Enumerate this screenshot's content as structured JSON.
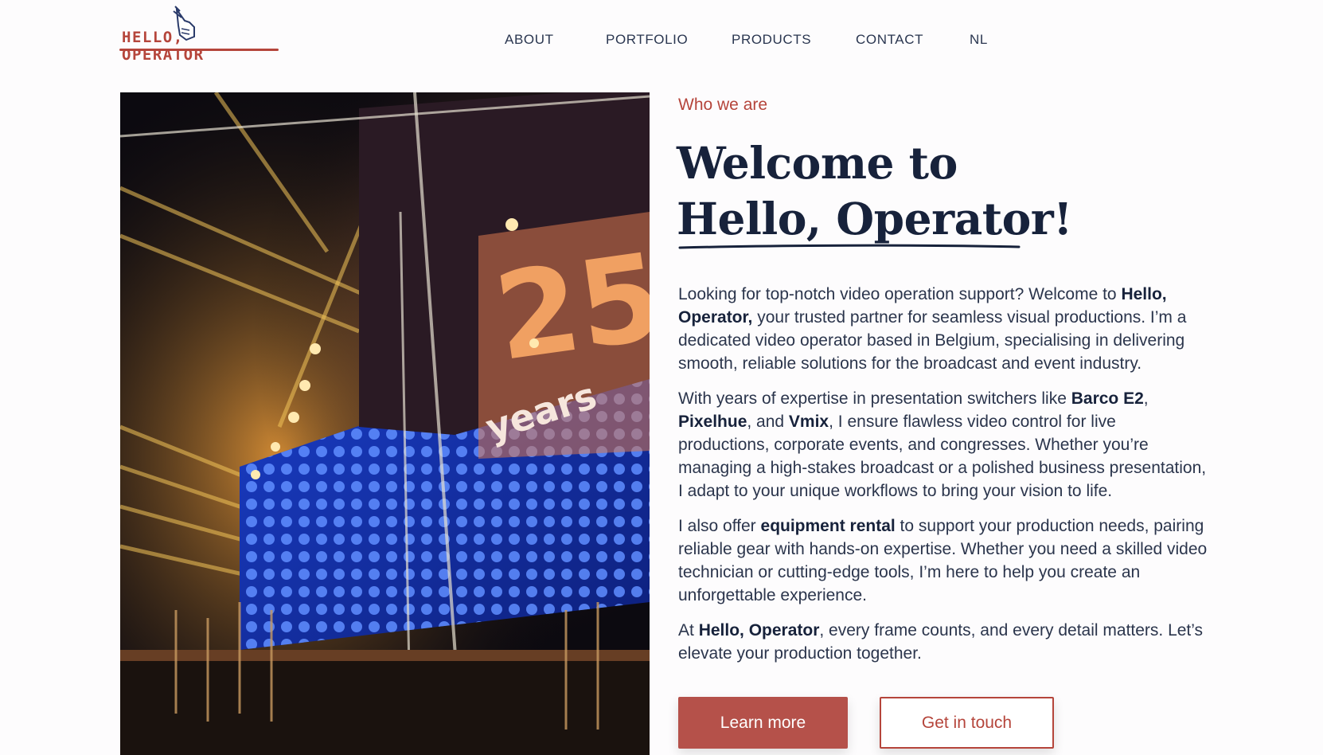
{
  "brand": {
    "logo_text_left": "HELLO,",
    "logo_text_right": "OPERATOR",
    "accent_color": "#b5453b",
    "navy_color": "#17223b"
  },
  "nav": {
    "items": [
      {
        "label": "ABOUT"
      },
      {
        "label": "PORTFOLIO"
      },
      {
        "label": "PRODUCTS"
      },
      {
        "label": "CONTACT"
      },
      {
        "label": "NL"
      }
    ]
  },
  "hero": {
    "image_overlay_number": "25",
    "image_overlay_word": "years"
  },
  "about": {
    "eyebrow": "Who we are",
    "heading_line1": "Welcome to",
    "heading_line2": "Hello, Operator!",
    "p1": [
      {
        "t": "Looking for top-notch video operation support? Welcome to "
      },
      {
        "t": "Hello, Operator,",
        "b": true
      },
      {
        "t": " your trusted partner for seamless visual productions. I’m a dedicated video operator based in Belgium, specialising in delivering smooth, reliable solutions for the broadcast and event industry."
      }
    ],
    "p2": [
      {
        "t": "With years of expertise in presentation switchers like "
      },
      {
        "t": "Barco E2",
        "b": true
      },
      {
        "t": ", "
      },
      {
        "t": "Pixelhue",
        "b": true
      },
      {
        "t": ", and "
      },
      {
        "t": "Vmix",
        "b": true
      },
      {
        "t": ", I ensure flawless video control for live productions, corporate events, and congresses. Whether you’re managing a high-stakes broadcast or a polished business presentation, I adapt to your unique workflows to bring your vision to life."
      }
    ],
    "p3": [
      {
        "t": "I also offer "
      },
      {
        "t": "equipment rental",
        "b": true
      },
      {
        "t": " to support your production needs, pairing reliable gear with hands-on expertise. Whether you need a skilled video technician or cutting-edge tools, I’m here to help you create an unforgettable experience."
      }
    ],
    "p4": [
      {
        "t": "At "
      },
      {
        "t": "Hello, Operator",
        "b": true
      },
      {
        "t": ", every frame counts, and every detail matters. Let’s elevate your production together."
      }
    ],
    "btn_primary": "Learn more",
    "btn_secondary": "Get in touch"
  }
}
